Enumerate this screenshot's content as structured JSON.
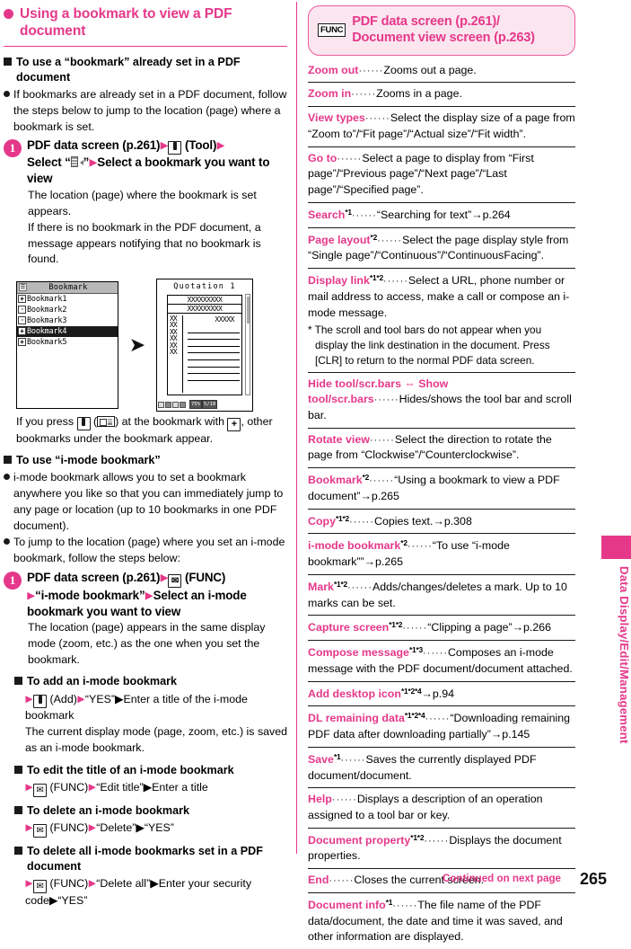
{
  "page": {
    "number": "265",
    "continued_label": "Continued on next page",
    "side_tab_label": "Data Display/Edit/Management"
  },
  "left": {
    "section_title": "Using a bookmark to view a PDF document",
    "sub1": {
      "heading": "To use a “bookmark” already set in a PDF document",
      "bullet1": "If bookmarks are already set in a PDF document, follow the steps below to jump to the location (page) where a bookmark is set.",
      "step": {
        "num": "1",
        "title_p1": "PDF data screen (p.261)",
        "title_key_tool": "(Tool)",
        "title_p2": "Select “",
        "title_p3": "”",
        "title_p4": "Select a bookmark you want to view",
        "desc1": "The location (page) where the bookmark is set appears.",
        "desc2": "If there is no bookmark in the PDF document, a message appears notifying that no bookmark is found."
      },
      "mock_bookmark": {
        "title": "Bookmark",
        "rows": [
          {
            "mark": "+",
            "label": "Bookmark1",
            "selected": false
          },
          {
            "mark": "▫",
            "label": "Bookmark2",
            "selected": false
          },
          {
            "mark": "▫",
            "label": "Bookmark3",
            "selected": false
          },
          {
            "mark": "+",
            "label": "Bookmark4",
            "selected": true
          },
          {
            "mark": "+",
            "label": "Bookmark5",
            "selected": false
          }
        ]
      },
      "mock_doc": {
        "title": "Quotation 1",
        "x_line_1": "XXXXXXXXX",
        "x_line_2": "XXXXXXXXX",
        "x_line_3": "XXXXX",
        "zoom_value": "75%",
        "page_value": "5/10"
      },
      "caption_p1": "If you press",
      "caption_p2": "(",
      "caption_p3": ") at the bookmark with",
      "caption_p4": ", other bookmarks under the bookmark appear."
    },
    "sub2": {
      "heading": "To use “i-mode bookmark”",
      "bullet1": "i-mode bookmark allows you to set a bookmark anywhere you like so that you can immediately jump to any page or location (up to 10 bookmarks in one PDF document).",
      "bullet2": "To jump to the location (page) where you set an i-mode bookmark, follow the steps below:",
      "step": {
        "num": "1",
        "title_p1": "PDF data screen (p.261)",
        "title_key_func": "(FUNC)",
        "title_p2": "“i-mode bookmark”",
        "title_p3": "Select an i-mode bookmark you want to view",
        "desc1": "The location (page) appears in the same display mode (zoom, etc.) as the one when you set the bookmark."
      },
      "ops": [
        {
          "heading": "To add an i-mode bookmark",
          "key": "tool",
          "key_label": "(Add)",
          "steps": "“YES”▶Enter a title of the i-mode bookmark",
          "note": "The current display mode (page, zoom, etc.) is saved as an i-mode bookmark."
        },
        {
          "heading": "To edit the title of an i-mode bookmark",
          "key": "mail",
          "key_label": "(FUNC)",
          "steps": "“Edit title”▶Enter a title",
          "note": ""
        },
        {
          "heading": "To delete an i-mode bookmark",
          "key": "mail",
          "key_label": "(FUNC)",
          "steps": "“Delete”▶“YES”",
          "note": ""
        },
        {
          "heading": "To delete all i-mode bookmarks set in a PDF document",
          "key": "mail",
          "key_label": "(FUNC)",
          "steps": "“Delete all”▶Enter your security code▶“YES”",
          "note": ""
        }
      ]
    }
  },
  "right": {
    "header": {
      "badge": "FUNC",
      "title_line1": "PDF data screen (p.261)/",
      "title_line2": "Document view screen (p.263)"
    },
    "functions": [
      {
        "name": "Zoom out",
        "sup": "",
        "desc": "Zooms out a page.",
        "note": ""
      },
      {
        "name": "Zoom in",
        "sup": "",
        "desc": "Zooms in a page.",
        "note": ""
      },
      {
        "name": "View types",
        "sup": "",
        "desc": "Select the display size of a page from “Zoom to”/“Fit page”/“Actual size”/“Fit width”.",
        "note": ""
      },
      {
        "name": "Go to",
        "sup": "",
        "desc": "Select a page to display from “First page”/“Previous page”/“Next page”/“Last page”/“Specified page”.",
        "note": ""
      },
      {
        "name": "Search",
        "sup": "*1",
        "desc": "“Searching for text”→p.264",
        "note": ""
      },
      {
        "name": "Page layout",
        "sup": "*2",
        "desc": "Select the page display style from “Single page”/“Continuous”/“ContinuousFacing”.",
        "note": ""
      },
      {
        "name": "Display link",
        "sup": "*1*2",
        "desc": "Select a URL, phone number or mail address to access, make a call or compose an i-mode message.",
        "note": "* The scroll and tool bars do not appear when you display the link destination in the document. Press [CLR] to return to the normal PDF data screen."
      },
      {
        "name": "Hide tool/scr.bars ⇔ Show tool/scr.bars",
        "sup": "",
        "desc": "Hides/shows the tool bar and scroll bar.",
        "note": "",
        "swap": true
      },
      {
        "name": "Rotate view",
        "sup": "",
        "desc": "Select the direction to rotate the page from “Clockwise”/“Counterclockwise”.",
        "note": ""
      },
      {
        "name": "Bookmark",
        "sup": "*2",
        "desc": "“Using a bookmark to view a PDF document”→p.265",
        "note": ""
      },
      {
        "name": "Copy",
        "sup": "*1*2",
        "desc": "Copies text.→p.308",
        "note": ""
      },
      {
        "name": "i-mode bookmark",
        "sup": "*2",
        "desc": "“To use “i-mode bookmark””→p.265",
        "note": ""
      },
      {
        "name": "Mark",
        "sup": "*1*2",
        "desc": "Adds/changes/deletes a mark. Up to 10 marks can be set.",
        "note": ""
      },
      {
        "name": "Capture screen",
        "sup": "*1*2",
        "desc": "“Clipping a page”→p.266",
        "note": ""
      },
      {
        "name": "Compose message",
        "sup": "*1*3",
        "desc": "Composes an i-mode message with the PDF document/document attached.",
        "note": ""
      },
      {
        "name": "Add desktop icon",
        "sup": "*1*2*4",
        "desc": "→p.94",
        "note": "",
        "no_dots": true
      },
      {
        "name": "DL remaining data",
        "sup": "*1*2*4",
        "desc": "“Downloading remaining PDF data after downloading partially”→p.145",
        "note": ""
      },
      {
        "name": "Save",
        "sup": "*1",
        "desc": "Saves the currently displayed PDF document/document.",
        "note": ""
      },
      {
        "name": "Help",
        "sup": "",
        "desc": "Displays a description of an operation assigned to a tool bar or key.",
        "note": ""
      },
      {
        "name": "Document property",
        "sup": "*1*2",
        "desc": "Displays the document properties.",
        "note": ""
      },
      {
        "name": "End",
        "sup": "",
        "desc": "Closes the current screen.",
        "note": ""
      },
      {
        "name": "Document info",
        "sup": "*1",
        "desc": "The file name of the PDF data/document, the date and time it was saved, and other information are displayed.",
        "note": ""
      }
    ]
  },
  "colors": {
    "accent": "#e5388a",
    "accent_light": "#fbe6ef",
    "text": "#000000"
  }
}
